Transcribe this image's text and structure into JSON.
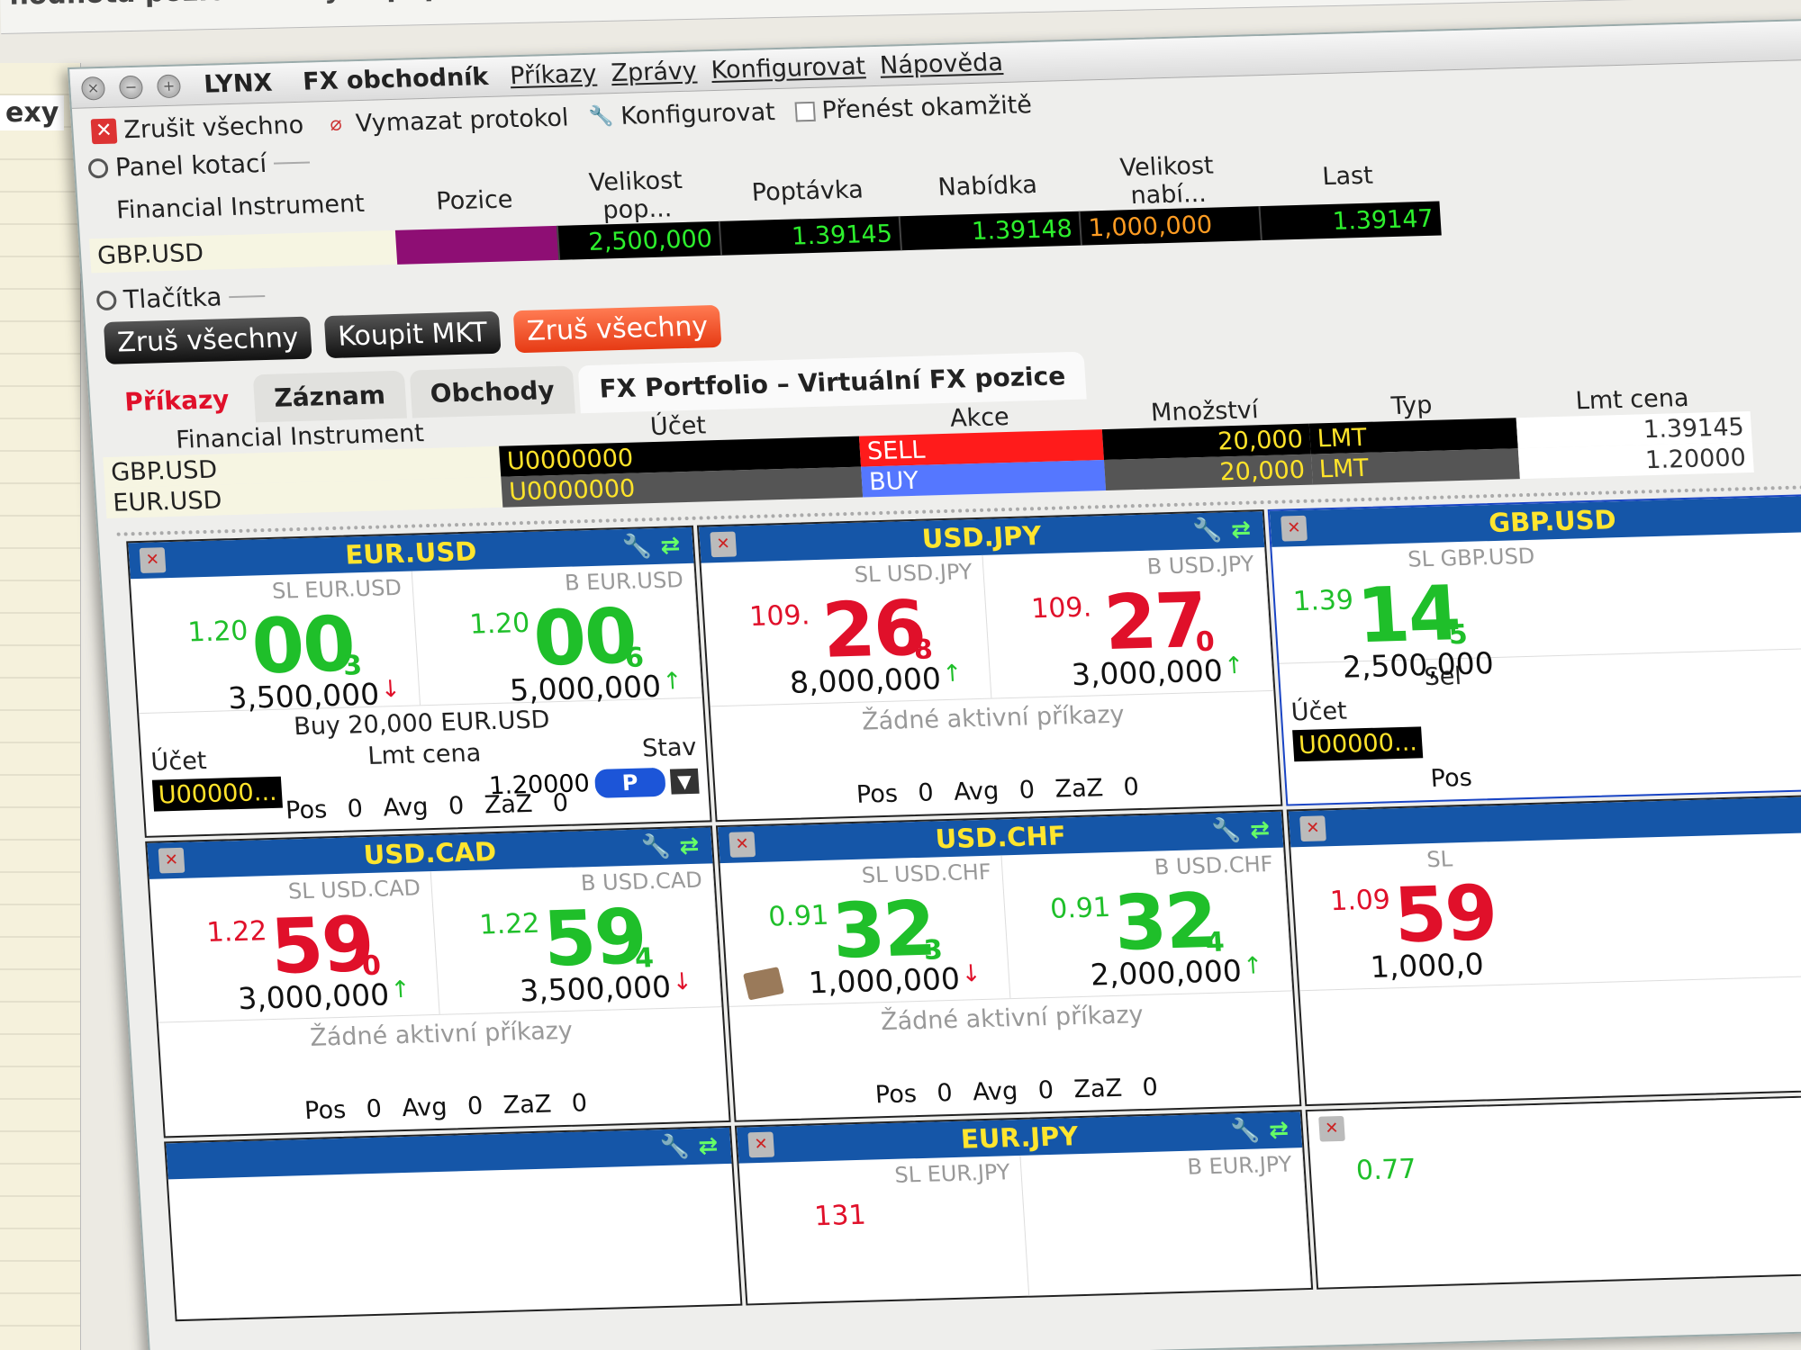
{
  "background": {
    "title_fragment": "hodnota pozice cenných papír",
    "side_label": "exy"
  },
  "window": {
    "app_name": "LYNX",
    "title": "FX obchodník",
    "menus": [
      "Příkazy",
      "Zprávy",
      "Konfigurovat",
      "Nápověda"
    ]
  },
  "toolbar": {
    "cancel_all": "Zrušit všechno",
    "clear_log": "Vymazat protokol",
    "configure": "Konfigurovat",
    "transmit_now": "Přenést okamžitě"
  },
  "quote_panel": {
    "title": "Panel kotací",
    "headers": [
      "Financial Instrument",
      "Pozice",
      "Velikost pop...",
      "Poptávka",
      "Nabídka",
      "Velikost nabí...",
      "Last"
    ],
    "row": {
      "instrument": "GBP.USD",
      "position": "",
      "bid_size": "2,500,000",
      "bid": "1.39145",
      "ask": "1.39148",
      "ask_size": "1,000,000",
      "last": "1.39147"
    }
  },
  "buttons_panel": {
    "title": "Tlačítka",
    "buttons": [
      "Zruš všechny",
      "Koupit MKT",
      "Zruš všechny"
    ]
  },
  "tabs": [
    "Příkazy",
    "Záznam",
    "Obchody",
    "FX Portfolio – Virtuální FX pozice"
  ],
  "orders": {
    "headers": [
      "Financial Instrument",
      "Účet",
      "Akce",
      "Množství",
      "Typ",
      "Lmt cena"
    ],
    "rows": [
      {
        "instrument": "GBP.USD",
        "account": "U0000000",
        "action": "SELL",
        "qty": "20,000",
        "type": "LMT",
        "lmt": "1.39145"
      },
      {
        "instrument": "EUR.USD",
        "account": "U0000000",
        "action": "BUY",
        "qty": "20,000",
        "type": "LMT",
        "lmt": "1.20000"
      }
    ]
  },
  "tiles": [
    {
      "pair": "EUR.USD",
      "sell": {
        "label": "SL EUR.USD",
        "prefix": "1.20",
        "big": "00",
        "frac": "3",
        "size": "3,500,000",
        "arrow": "↓",
        "color": "g",
        "arrow_color": "r"
      },
      "buy": {
        "label": "B EUR.USD",
        "prefix": "1.20",
        "big": "00",
        "frac": "6",
        "size": "5,000,000",
        "arrow": "↑",
        "color": "g",
        "arrow_color": "g"
      },
      "order": {
        "line": "Buy 20,000 EUR.USD",
        "account_label": "Účet",
        "lmt_label": "Lmt cena",
        "status_label": "Stav",
        "account": "U00000...",
        "lmt": "1.20000",
        "status": "P"
      },
      "footer": "Pos 0 Avg 0 ZaZ 0"
    },
    {
      "pair": "USD.JPY",
      "sell": {
        "label": "SL USD.JPY",
        "prefix": "109.",
        "big": "26",
        "frac": "8",
        "size": "8,000,000",
        "arrow": "↑",
        "color": "r",
        "arrow_color": "g"
      },
      "buy": {
        "label": "B USD.JPY",
        "prefix": "109.",
        "big": "27",
        "frac": "0",
        "size": "3,000,000",
        "arrow": "↑",
        "color": "r",
        "arrow_color": "g"
      },
      "no_orders": "Žádné aktivní příkazy",
      "footer": "Pos 0 Avg 0 ZaZ 0"
    },
    {
      "pair": "GBP.USD",
      "sell": {
        "label": "SL GBP.USD",
        "prefix": "1.39",
        "big": "14",
        "frac": "5",
        "size": "2,500,000",
        "arrow": "",
        "color": "g",
        "arrow_color": "g"
      },
      "order": {
        "line": "Sel",
        "account_label": "Účet",
        "account": "U00000..."
      },
      "footer": "Pos"
    },
    {
      "pair": "USD.CAD",
      "sell": {
        "label": "SL USD.CAD",
        "prefix": "1.22",
        "big": "59",
        "frac": "0",
        "size": "3,000,000",
        "arrow": "↑",
        "color": "r",
        "arrow_color": "g"
      },
      "buy": {
        "label": "B USD.CAD",
        "prefix": "1.22",
        "big": "59",
        "frac": "4",
        "size": "3,500,000",
        "arrow": "↓",
        "color": "g",
        "arrow_color": "r"
      },
      "no_orders": "Žádné aktivní příkazy",
      "footer": "Pos 0 Avg 0 ZaZ 0"
    },
    {
      "pair": "USD.CHF",
      "sell": {
        "label": "SL USD.CHF",
        "prefix": "0.91",
        "big": "32",
        "frac": "3",
        "size": "1,000,000",
        "arrow": "↓",
        "color": "g",
        "arrow_color": "r"
      },
      "buy": {
        "label": "B USD.CHF",
        "prefix": "0.91",
        "big": "32",
        "frac": "4",
        "size": "2,000,000",
        "arrow": "↑",
        "color": "g",
        "arrow_color": "g"
      },
      "no_orders": "Žádné aktivní příkazy",
      "footer": "Pos 0 Avg 0 ZaZ 0"
    },
    {
      "pair": "",
      "sell": {
        "label": "SL",
        "prefix": "1.09",
        "big": "59",
        "frac": "",
        "size": "1,000,0",
        "arrow": "",
        "color": "r",
        "arrow_color": "g"
      },
      "footer": ""
    }
  ],
  "bottom_tiles": [
    {
      "pair": "",
      "footer": ""
    },
    {
      "pair": "EUR.JPY",
      "sell_label": "SL EUR.JPY",
      "buy_label": "B EUR.JPY",
      "sell_prefix": "131"
    },
    {
      "pair": "",
      "sell_prefix": "0.77"
    }
  ],
  "colors": {
    "header_blue": "#1556a8",
    "pair_yellow": "#ffe52e",
    "green": "#1fbf2a",
    "red": "#e0102a",
    "order_tab_red": "#e0102a"
  }
}
